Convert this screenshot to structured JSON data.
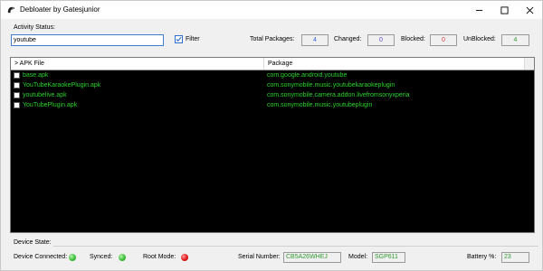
{
  "window": {
    "title": "Debloater by Gatesjunior"
  },
  "activity": {
    "label": "Activity Status:",
    "search_value": "youtube",
    "filter_label": "Filter",
    "filter_checked": true
  },
  "stats": {
    "total_label": "Total Packages:",
    "total_value": "4",
    "changed_label": "Changed:",
    "changed_value": "0",
    "blocked_label": "Blocked:",
    "blocked_value": "0",
    "unblocked_label": "UnBlocked:",
    "unblocked_value": "4",
    "colors": {
      "total": "#3b5fd6",
      "changed": "#5a48d0",
      "blocked": "#d83a3a",
      "unblocked": "#2f9a2f"
    }
  },
  "list": {
    "columns": [
      "> APK File",
      "Package"
    ],
    "rows": [
      {
        "file": "base.apk",
        "package": "com.google.android.youtube",
        "checked": false
      },
      {
        "file": "YouTubeKaraokePlugin.apk",
        "package": "com.sonymobile.music.youtubekaraokeplugin",
        "checked": false
      },
      {
        "file": "youtubelive.apk",
        "package": "com.sonymobile.camera.addon.livefromsonyxperia",
        "checked": false
      },
      {
        "file": "YouTubePlugin.apk",
        "package": "com.sonymobile.music.youtubeplugin",
        "checked": false
      }
    ],
    "text_color": "#2bd22b"
  },
  "device": {
    "state_label": "Device State:",
    "connected_label": "Device Connected:",
    "connected_status": "green",
    "synced_label": "Synced:",
    "synced_status": "green",
    "root_label": "Root Mode:",
    "root_status": "red",
    "serial_label": "Serial Number:",
    "serial_value": "CB5A26WHEJ",
    "model_label": "Model:",
    "model_value": "SGP611",
    "battery_label": "Battery %:",
    "battery_value": "23"
  }
}
